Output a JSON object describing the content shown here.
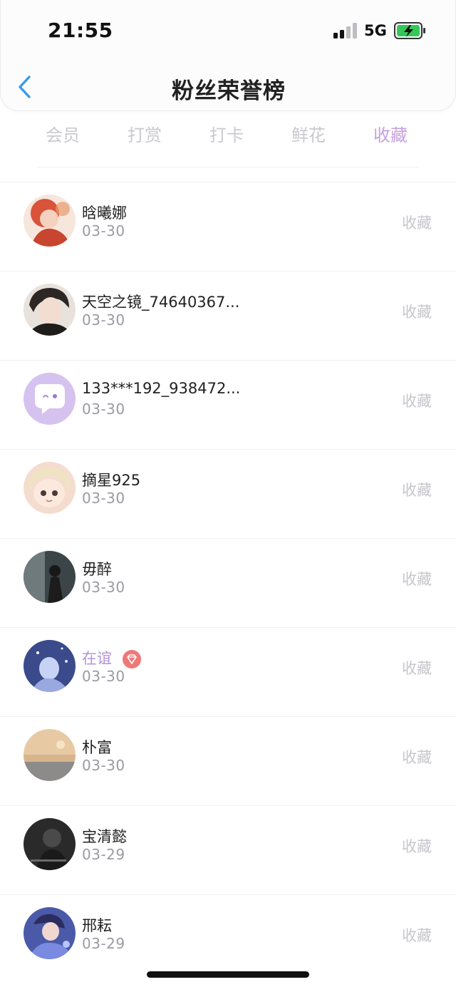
{
  "status_bar": {
    "time": "21:55",
    "network": "5G"
  },
  "nav": {
    "title": "粉丝荣誉榜"
  },
  "tabs": [
    {
      "label": "会员",
      "active": false
    },
    {
      "label": "打赏",
      "active": false
    },
    {
      "label": "打卡",
      "active": false
    },
    {
      "label": "鲜花",
      "active": false
    },
    {
      "label": "收藏",
      "active": true
    }
  ],
  "colors": {
    "accent": "#c6a0df",
    "back_arrow": "#3b9ae8",
    "vip_name": "#b394d8",
    "badge": "#f07878"
  },
  "fans": [
    {
      "name": "晗曦娜",
      "date": "03-30",
      "action": "收藏"
    },
    {
      "name": "天空之镜_74640367...",
      "date": "03-30",
      "action": "收藏"
    },
    {
      "name": "133***192_938472...",
      "date": "03-30",
      "action": "收藏"
    },
    {
      "name": "摘星925",
      "date": "03-30",
      "action": "收藏"
    },
    {
      "name": "毋醉",
      "date": "03-30",
      "action": "收藏"
    },
    {
      "name": "在谊",
      "date": "03-30",
      "action": "收藏",
      "badge_icon": "diamond-icon"
    },
    {
      "name": "朴富",
      "date": "03-30",
      "action": "收藏"
    },
    {
      "name": "宝清懿",
      "date": "03-29",
      "action": "收藏"
    },
    {
      "name": "邢耘",
      "date": "03-29",
      "action": "收藏"
    }
  ]
}
